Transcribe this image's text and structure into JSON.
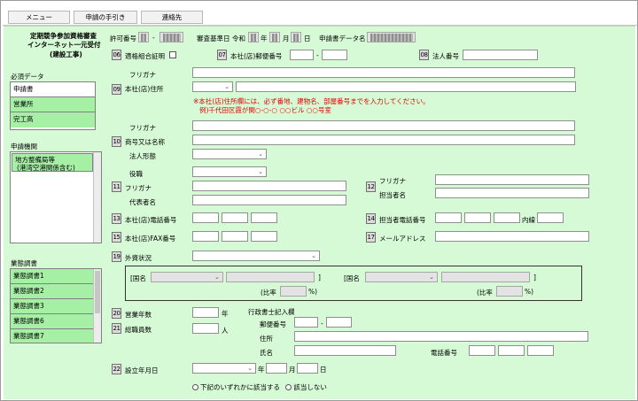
{
  "menu": {
    "items": [
      {
        "label": "メニュー"
      },
      {
        "label": "申請の手引き"
      },
      {
        "label": "連絡先"
      }
    ]
  },
  "header": {
    "title_line1": "定期競争参加資格審査",
    "title_line2": "インターネット一元受付",
    "title_line3": "(建設工事)",
    "permit_label": "許可番号",
    "permit_sep": "-",
    "review_label": "審査基準日",
    "era": "令和",
    "year_unit": "年",
    "month_unit": "月",
    "day_unit": "日",
    "app_data_label": "申請書データ名"
  },
  "sidebar": {
    "required_title": "必須データ",
    "required_items": [
      "申請書",
      "営業所",
      "完工高"
    ],
    "agency_title": "申請機関",
    "agency_item_line1": "地方整備局等",
    "agency_item_line2": "(港湾空港関係含む)",
    "business_title": "業態調書",
    "business_items": [
      "業態調書1",
      "業態調書2",
      "業態調書3",
      "業態調書6",
      "業態調書7"
    ]
  },
  "form": {
    "f06": {
      "num": "06",
      "label": "適格組合証明"
    },
    "f07": {
      "num": "07",
      "label": "本社(店)郵便番号",
      "sep": "-"
    },
    "f08": {
      "num": "08",
      "label": "法人番号"
    },
    "f09": {
      "furigana": "フリガナ",
      "num": "09",
      "label": "本社(店)住所",
      "note_line1": "※本社(店)住所欄には、必ず番地、建物名、部屋番号までを入力してください。",
      "note_line2": "例)千代田区霞が関○-○-○ ○○ビル ○○号室"
    },
    "f10": {
      "furigana": "フリガナ",
      "num": "10",
      "label": "商号又は名称",
      "legal_form": "法人形態"
    },
    "f11": {
      "role": "役職",
      "num": "11",
      "furigana": "フリガナ",
      "label": "代表者名"
    },
    "f12": {
      "num": "12",
      "furigana": "フリガナ",
      "label": "担当者名"
    },
    "f13": {
      "num": "13",
      "label": "本社(店)電話番号"
    },
    "f14": {
      "num": "14",
      "label": "担当者電話番号",
      "ext": "内線"
    },
    "f15": {
      "num": "15",
      "label": "本社(店)FAX番号"
    },
    "f17": {
      "num": "17",
      "label": "メールアドレス"
    },
    "f19": {
      "num": "19",
      "label": "外資状況",
      "country_label": "[国名",
      "bracket_close": "]",
      "ratio_open": "(比率",
      "ratio_close": "%)"
    },
    "f20": {
      "num": "20",
      "label": "営業年数",
      "unit": "年"
    },
    "f21": {
      "num": "21",
      "label": "総職員数",
      "unit": "人"
    },
    "scrivener": {
      "title": "行政書士記入欄",
      "postal": "郵便番号",
      "postal_sep": "-",
      "address": "住所",
      "name": "氏名",
      "phone": "電話番号"
    },
    "f22": {
      "num": "22",
      "label": "設立年月日",
      "year": "年",
      "month": "月",
      "day": "日",
      "radio_none_label": "下記のいずれかに該当する",
      "radio_applicable_label": "該当しない"
    }
  }
}
